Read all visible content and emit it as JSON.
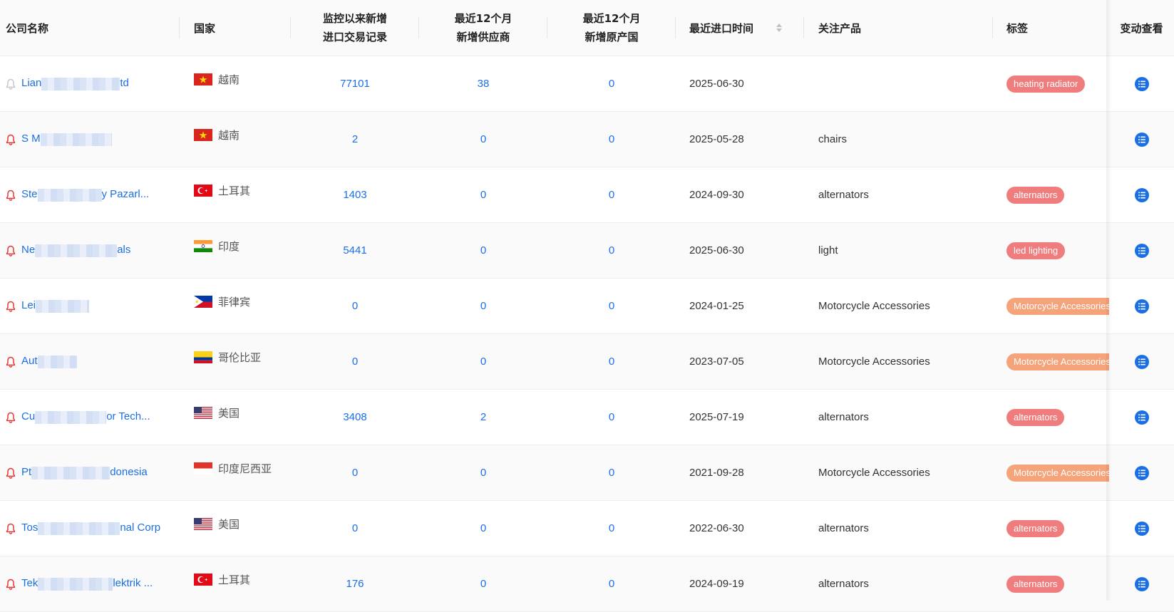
{
  "columns": {
    "company": "公司名称",
    "country": "国家",
    "records_l1": "监控以来新增",
    "records_l2": "进口交易记录",
    "suppliers_l1": "最近12个月",
    "suppliers_l2": "新增供应商",
    "origins_l1": "最近12个月",
    "origins_l2": "新增原产国",
    "last_import": "最近进口时间",
    "product": "关注产品",
    "tags": "标签",
    "changes": "变动查看"
  },
  "colors": {
    "link": "#1a6fe6",
    "bell_on": "#e53935",
    "bell_off": "#c8c8c8",
    "tag_red": "#f07d7d",
    "tag_orange": "#f4a37a"
  },
  "rows": [
    {
      "company_start": "Lian",
      "company_end": "td",
      "bell": "off",
      "flag": "vietnam",
      "country": "越南",
      "records": "77101",
      "suppliers": "38",
      "origins": "0",
      "date": "2025-06-30",
      "product": "",
      "tag": "heating radiator",
      "tag_color": "red"
    },
    {
      "company_start": "S M",
      "company_end": "",
      "bell": "on",
      "flag": "vietnam",
      "country": "越南",
      "records": "2",
      "suppliers": "0",
      "origins": "0",
      "date": "2025-05-28",
      "product": "chairs",
      "tag": "",
      "tag_color": ""
    },
    {
      "company_start": "Ste",
      "company_end": "y Pazarl...",
      "bell": "on",
      "flag": "turkey",
      "country": "土耳其",
      "records": "1403",
      "suppliers": "0",
      "origins": "0",
      "date": "2024-09-30",
      "product": "alternators",
      "tag": "alternators",
      "tag_color": "red"
    },
    {
      "company_start": "Ne",
      "company_end": "als",
      "bell": "on",
      "flag": "india",
      "country": "印度",
      "records": "5441",
      "suppliers": "0",
      "origins": "0",
      "date": "2025-06-30",
      "product": "light",
      "tag": "led lighting",
      "tag_color": "red"
    },
    {
      "company_start": "Lei",
      "company_end": "",
      "bell": "on",
      "flag": "philippines",
      "country": "菲律宾",
      "records": "0",
      "suppliers": "0",
      "origins": "0",
      "date": "2024-01-25",
      "product": "Motorcycle Accessories",
      "tag": "Motorcycle Accessories",
      "tag_color": "orange"
    },
    {
      "company_start": "Aut",
      "company_end": "",
      "bell": "on",
      "flag": "colombia",
      "country": "哥伦比亚",
      "records": "0",
      "suppliers": "0",
      "origins": "0",
      "date": "2023-07-05",
      "product": "Motorcycle Accessories",
      "tag": "Motorcycle Accessories",
      "tag_color": "orange"
    },
    {
      "company_start": "Cu",
      "company_end": "or Tech...",
      "bell": "on",
      "flag": "usa",
      "country": "美国",
      "records": "3408",
      "suppliers": "2",
      "origins": "0",
      "date": "2025-07-19",
      "product": "alternators",
      "tag": "alternators",
      "tag_color": "red"
    },
    {
      "company_start": "Pt",
      "company_end": "donesia",
      "bell": "on",
      "flag": "indonesia",
      "country": "印度尼西亚",
      "records": "0",
      "suppliers": "0",
      "origins": "0",
      "date": "2021-09-28",
      "product": "Motorcycle Accessories",
      "tag": "Motorcycle Accessories",
      "tag_color": "orange"
    },
    {
      "company_start": "Tos",
      "company_end": "nal Corp",
      "bell": "on",
      "flag": "usa",
      "country": "美国",
      "records": "0",
      "suppliers": "0",
      "origins": "0",
      "date": "2022-06-30",
      "product": "alternators",
      "tag": "alternators",
      "tag_color": "red"
    },
    {
      "company_start": "Tek",
      "company_end": "lektrik ...",
      "bell": "on",
      "flag": "turkey",
      "country": "土耳其",
      "records": "176",
      "suppliers": "0",
      "origins": "0",
      "date": "2024-09-19",
      "product": "alternators",
      "tag": "alternators",
      "tag_color": "red"
    }
  ]
}
